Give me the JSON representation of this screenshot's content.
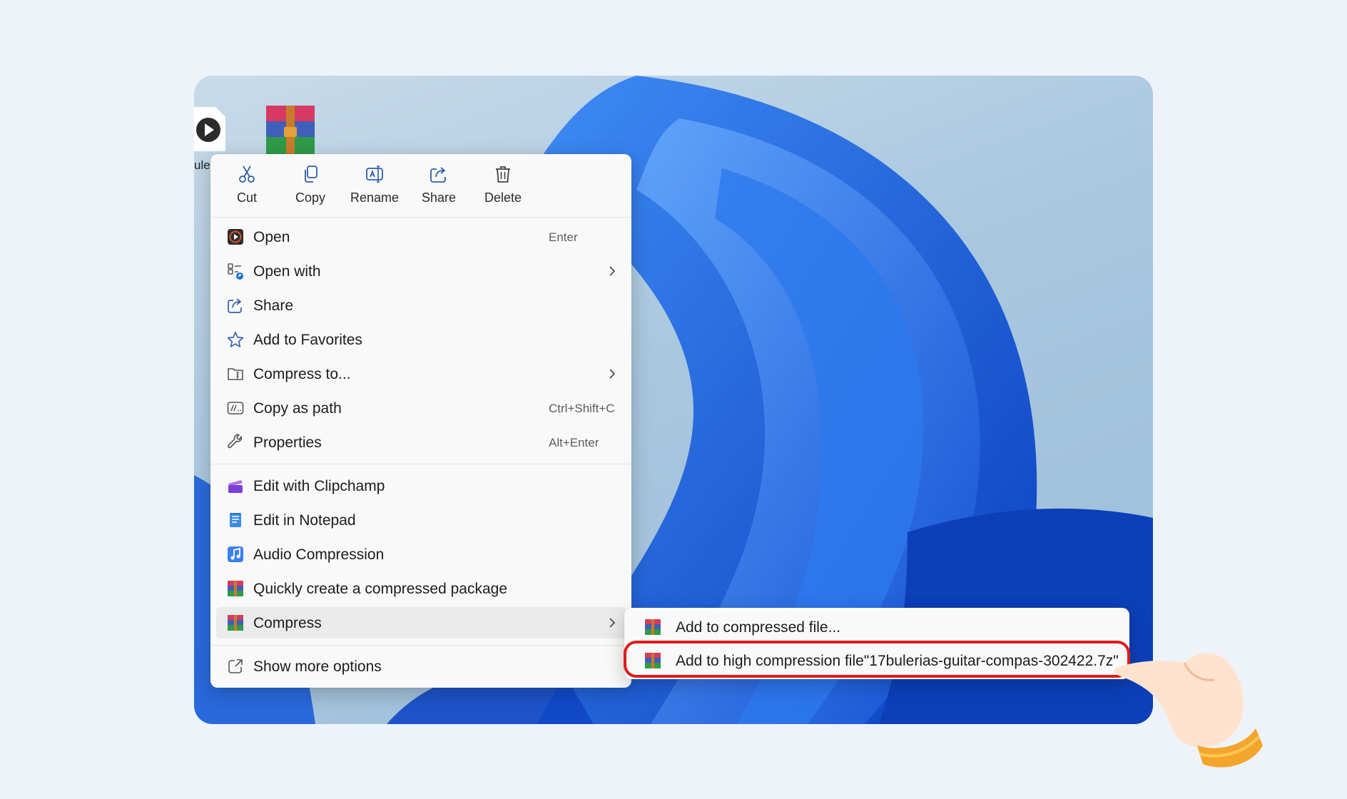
{
  "desktop": {
    "icons": [
      {
        "name": "audio-file",
        "label": "ule"
      },
      {
        "name": "winrar-archive",
        "label": ""
      }
    ]
  },
  "toolbar": {
    "items": [
      {
        "label": "Cut",
        "icon": "scissors-icon"
      },
      {
        "label": "Copy",
        "icon": "copy-icon"
      },
      {
        "label": "Rename",
        "icon": "rename-icon"
      },
      {
        "label": "Share",
        "icon": "share-icon"
      },
      {
        "label": "Delete",
        "icon": "trash-icon"
      }
    ]
  },
  "menu": {
    "items": [
      {
        "label": "Open",
        "shortcut": "Enter",
        "icon": "media-play-icon"
      },
      {
        "label": "Open with",
        "shortcut": "",
        "icon": "open-with-icon",
        "submenu": true
      },
      {
        "label": "Share",
        "shortcut": "",
        "icon": "share-icon"
      },
      {
        "label": "Add to Favorites",
        "shortcut": "",
        "icon": "star-icon"
      },
      {
        "label": "Compress to...",
        "shortcut": "",
        "icon": "zip-folder-icon",
        "submenu": true
      },
      {
        "label": "Copy as path",
        "shortcut": "Ctrl+Shift+C",
        "icon": "path-icon"
      },
      {
        "label": "Properties",
        "shortcut": "Alt+Enter",
        "icon": "wrench-icon"
      },
      {
        "label": "Edit with Clipchamp",
        "shortcut": "",
        "icon": "clipchamp-icon"
      },
      {
        "label": "Edit in Notepad",
        "shortcut": "",
        "icon": "notepad-icon"
      },
      {
        "label": "Audio Compression",
        "shortcut": "",
        "icon": "music-note-icon"
      },
      {
        "label": "Quickly create a compressed package",
        "shortcut": "",
        "icon": "winrar-icon"
      },
      {
        "label": "Compress",
        "shortcut": "",
        "icon": "winrar-icon",
        "submenu": true,
        "selected": true
      },
      {
        "label": "Show more options",
        "shortcut": "",
        "icon": "more-options-icon"
      }
    ]
  },
  "submenu": {
    "items": [
      {
        "label": "Add to compressed file...",
        "icon": "winrar-icon"
      },
      {
        "label": "Add to high compression file\"17bulerias-guitar-compas-302422.7z\"",
        "icon": "winrar-icon",
        "highlighted": true
      }
    ]
  },
  "colors": {
    "highlight": "#e11b1b",
    "accent": "#1a6fd6",
    "menu_bg": "#f9f9f9"
  }
}
